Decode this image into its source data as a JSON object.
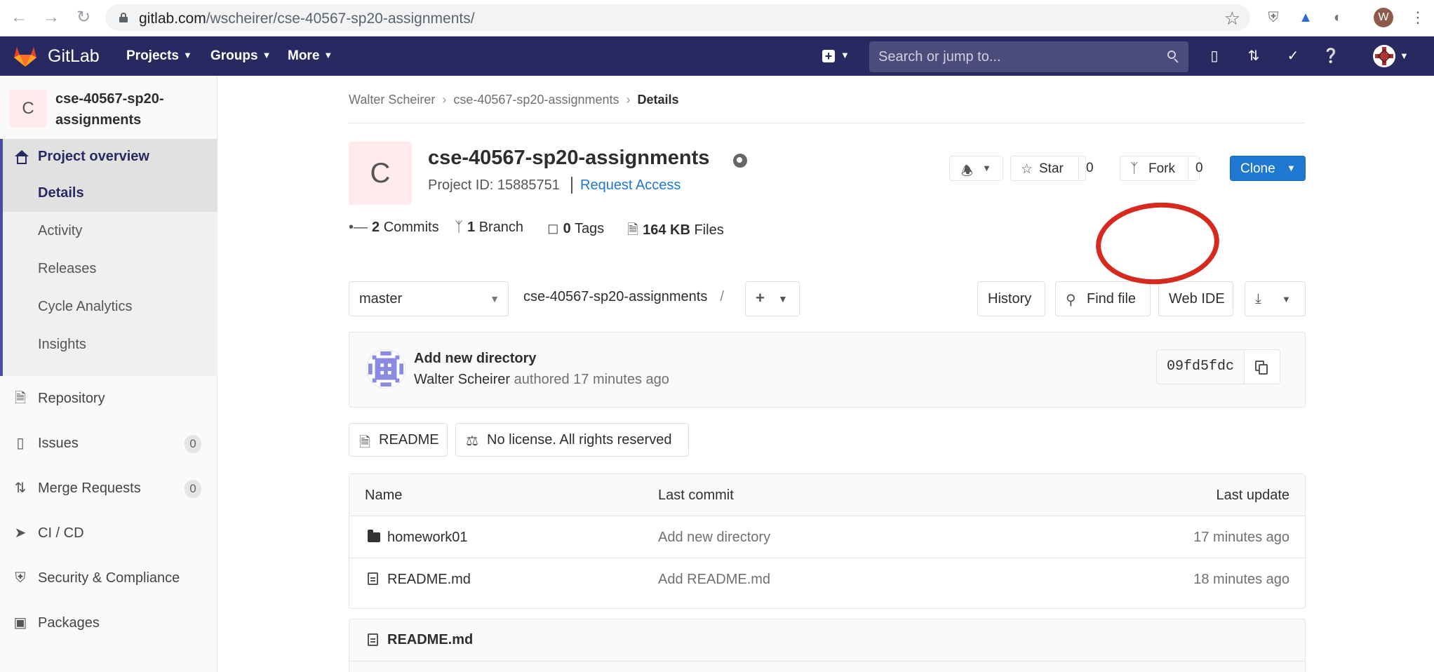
{
  "browser": {
    "url_host": "gitlab.com",
    "url_path": "/wscheirer/cse-40567-sp20-assignments/",
    "profile_initial": "W"
  },
  "topbar": {
    "brand": "GitLab",
    "nav": [
      "Projects",
      "Groups",
      "More"
    ],
    "search_placeholder": "Search or jump to..."
  },
  "sidebar": {
    "project_initial": "C",
    "project_name": "cse-40567-sp20-assignments",
    "overview_label": "Project overview",
    "overview_items": [
      {
        "label": "Details",
        "active": true
      },
      {
        "label": "Activity"
      },
      {
        "label": "Releases"
      },
      {
        "label": "Cycle Analytics"
      },
      {
        "label": "Insights"
      }
    ],
    "items": [
      {
        "label": "Repository",
        "icon": "document-icon"
      },
      {
        "label": "Issues",
        "icon": "issues-icon",
        "badge": "0"
      },
      {
        "label": "Merge Requests",
        "icon": "merge-request-icon",
        "badge": "0"
      },
      {
        "label": "CI / CD",
        "icon": "rocket-icon"
      },
      {
        "label": "Security & Compliance",
        "icon": "shield-icon"
      },
      {
        "label": "Packages",
        "icon": "package-icon"
      }
    ]
  },
  "breadcrumb": [
    "Walter Scheirer",
    "cse-40567-sp20-assignments",
    "Details"
  ],
  "project": {
    "initial": "C",
    "title": "cse-40567-sp20-assignments",
    "id_text": "Project ID: 15885751",
    "request_access": "Request Access",
    "star_label": "Star",
    "star_count": "0",
    "fork_label": "Fork",
    "fork_count": "0",
    "clone_label": "Clone"
  },
  "stats": [
    {
      "value": "2",
      "label": "Commits",
      "icon": "commit-icon"
    },
    {
      "value": "1",
      "label": "Branch",
      "icon": "branch-icon"
    },
    {
      "value": "0",
      "label": "Tags",
      "icon": "tag-icon"
    },
    {
      "value": "164 KB",
      "label": "Files",
      "icon": "files-icon"
    }
  ],
  "repo_toolbar": {
    "branch": "master",
    "path": "cse-40567-sp20-assignments",
    "path_sep": "/",
    "history": "History",
    "find_file": "Find file",
    "web_ide": "Web IDE"
  },
  "last_commit": {
    "title": "Add new directory",
    "author": "Walter Scheirer",
    "meta": "authored 17 minutes ago",
    "sha": "09fd5fdc"
  },
  "pills": {
    "readme": "README",
    "license": "No license. All rights reserved"
  },
  "files_table": {
    "headers": [
      "Name",
      "Last commit",
      "Last update"
    ],
    "rows": [
      {
        "name": "homework01",
        "type": "folder",
        "commit": "Add new directory",
        "update": "17 minutes ago"
      },
      {
        "name": "README.md",
        "type": "file",
        "commit": "Add README.md",
        "update": "18 minutes ago"
      }
    ]
  },
  "readme_header": "README.md",
  "colors": {
    "topbar": "#292961",
    "link": "#1f78d1",
    "clone_button": "#1f78d1",
    "annotation_circle": "#d62a1e"
  }
}
